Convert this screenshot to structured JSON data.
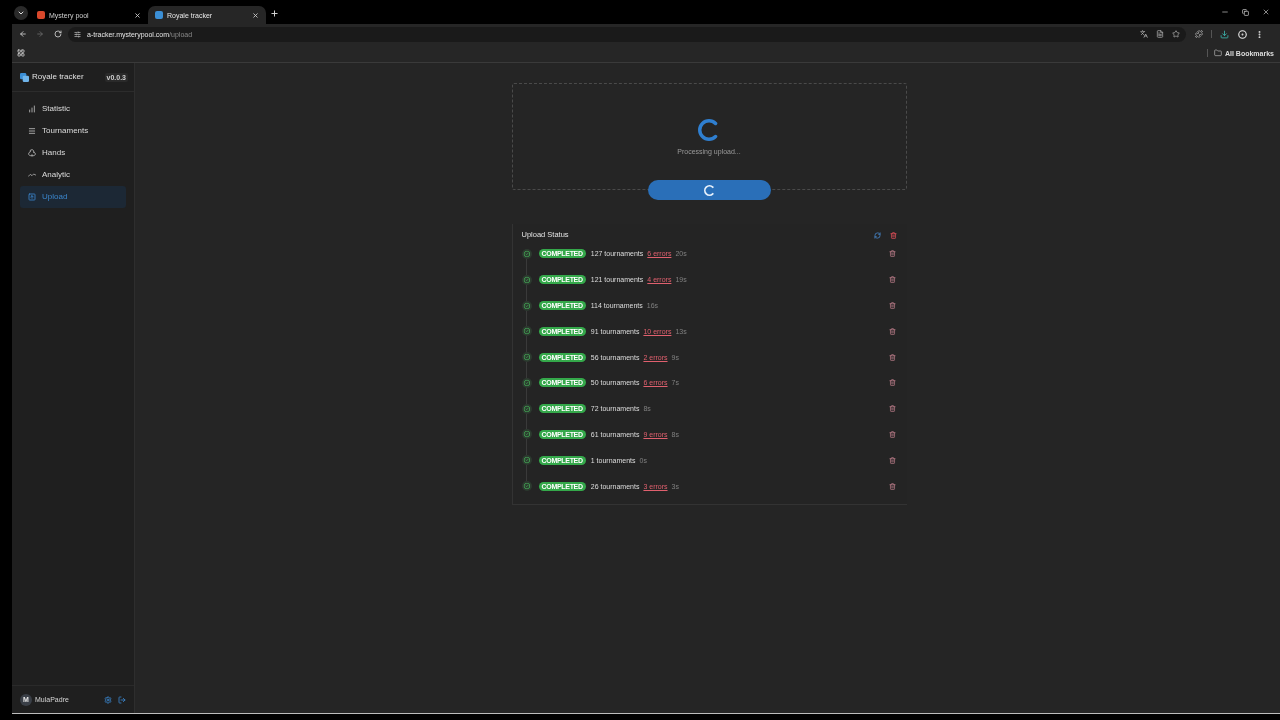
{
  "browser": {
    "tabs": [
      {
        "title": "Mystery pool",
        "selected": false,
        "color": "#d9482b"
      },
      {
        "title": "Royale tracker",
        "selected": true,
        "color": "#3b8fd6"
      }
    ],
    "url": {
      "host": "a-tracker.mysterypool.com",
      "path": "/upload"
    },
    "bookmarks_bar": {
      "label": "All Bookmarks"
    }
  },
  "sidebar": {
    "app_name": "Royale tracker",
    "version": "v0.0.3",
    "items": [
      {
        "label": "Statistic",
        "selected": false
      },
      {
        "label": "Tournaments",
        "selected": false
      },
      {
        "label": "Hands",
        "selected": false
      },
      {
        "label": "Analytic",
        "selected": false
      },
      {
        "label": "Upload",
        "selected": true
      }
    ],
    "user": {
      "initial": "M",
      "name": "MulaPadre"
    }
  },
  "dropzone": {
    "message": "Processing upload..."
  },
  "upload_button": {
    "loading": true
  },
  "upload_status": {
    "title": "Upload Status",
    "rows": [
      {
        "status": "COMPLETED",
        "tournaments": "127 tournaments",
        "errors": "6 errors",
        "duration": "20s"
      },
      {
        "status": "COMPLETED",
        "tournaments": "121 tournaments",
        "errors": "4 errors",
        "duration": "19s"
      },
      {
        "status": "COMPLETED",
        "tournaments": "114 tournaments",
        "duration": "16s"
      },
      {
        "status": "COMPLETED",
        "tournaments": "91 tournaments",
        "errors": "10 errors",
        "duration": "13s"
      },
      {
        "status": "COMPLETED",
        "tournaments": "56 tournaments",
        "errors": "2 errors",
        "duration": "9s"
      },
      {
        "status": "COMPLETED",
        "tournaments": "50 tournaments",
        "errors": "6 errors",
        "duration": "7s"
      },
      {
        "status": "COMPLETED",
        "tournaments": "72 tournaments",
        "duration": "8s"
      },
      {
        "status": "COMPLETED",
        "tournaments": "61 tournaments",
        "errors": "9 errors",
        "duration": "8s"
      },
      {
        "status": "COMPLETED",
        "tournaments": "1 tournaments",
        "duration": "0s"
      },
      {
        "status": "COMPLETED",
        "tournaments": "26 tournaments",
        "errors": "3 errors",
        "duration": "3s"
      }
    ]
  }
}
